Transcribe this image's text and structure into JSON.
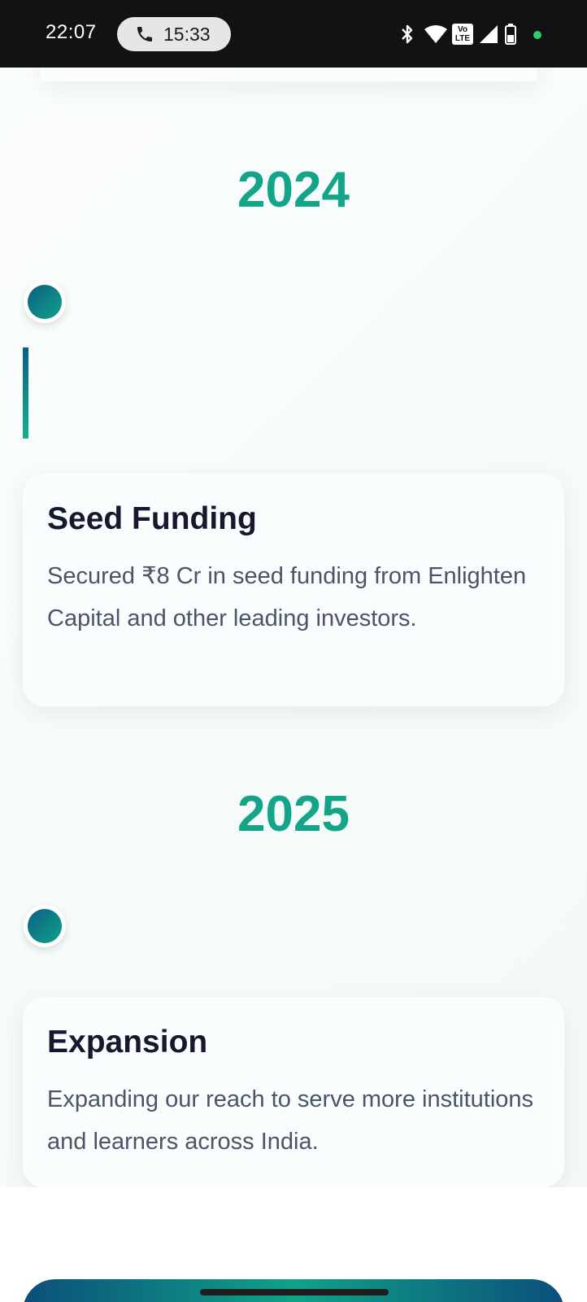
{
  "status_bar": {
    "time": "22:07",
    "call_timer": "15:33",
    "icons": [
      "bluetooth-icon",
      "wifi-icon",
      "volte-icon",
      "signal-icon",
      "battery-icon",
      "notification-dot"
    ],
    "volte_label_top": "Vo",
    "volte_label_bottom": "LTE"
  },
  "timeline": {
    "entries": [
      {
        "year": "2024",
        "title": "Seed Funding",
        "description": "Secured ₹8 Cr in seed funding from Enlighten Capital and other leading investors."
      },
      {
        "year": "2025",
        "title": "Expansion",
        "description": "Expanding our reach to serve more institutions and learners across India."
      }
    ]
  },
  "colors": {
    "accent": "#14a589",
    "gradient_start": "#0b5f85",
    "gradient_end": "#10a287",
    "title_text": "#141a2e",
    "body_text": "#4b5567",
    "status_bar_bg": "#121212"
  }
}
